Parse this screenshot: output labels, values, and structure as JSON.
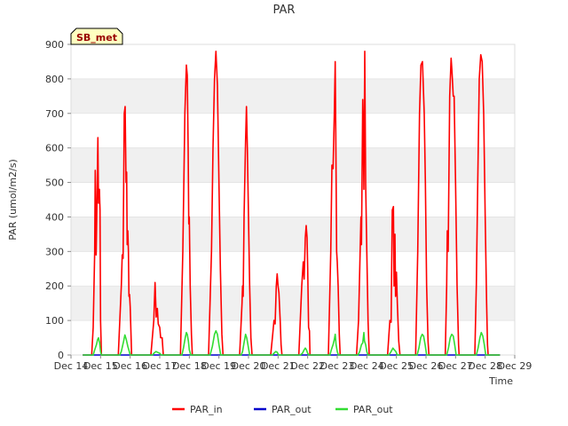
{
  "chart_data": {
    "type": "line",
    "title": "PAR",
    "xlabel": "Time",
    "ylabel": "PAR (umol/m2/s)",
    "ylim": [
      0,
      900
    ],
    "xlim": [
      14,
      29
    ],
    "yticks": [
      0,
      100,
      200,
      300,
      400,
      500,
      600,
      700,
      800,
      900
    ],
    "xtick_values": [
      14,
      15,
      16,
      17,
      18,
      19,
      20,
      21,
      22,
      23,
      24,
      25,
      26,
      27,
      28,
      29
    ],
    "xtick_labels": [
      "Dec 14",
      "Dec 15",
      "Dec 16",
      "Dec 17",
      "Dec 18",
      "Dec 19",
      "Dec 20",
      "Dec 21",
      "Dec 22",
      "Dec 23",
      "Dec 24",
      "Dec 25",
      "Dec 26",
      "Dec 27",
      "Dec 28",
      "Dec 29"
    ],
    "grid": "horizontal bands",
    "legend_placement": "bottom-center",
    "site_label": "SB_met",
    "series": [
      {
        "name": "PAR_in",
        "color": "#ff0000",
        "points": [
          [
            14.4,
            0
          ],
          [
            14.7,
            0
          ],
          [
            14.75,
            80
          ],
          [
            14.8,
            300
          ],
          [
            14.82,
            535
          ],
          [
            14.85,
            290
          ],
          [
            14.88,
            450
          ],
          [
            14.91,
            630
          ],
          [
            14.93,
            440
          ],
          [
            14.96,
            480
          ],
          [
            14.98,
            420
          ],
          [
            15.0,
            100
          ],
          [
            15.03,
            0
          ],
          [
            15.6,
            0
          ],
          [
            15.7,
            200
          ],
          [
            15.73,
            290
          ],
          [
            15.76,
            280
          ],
          [
            15.8,
            700
          ],
          [
            15.83,
            720
          ],
          [
            15.86,
            500
          ],
          [
            15.88,
            530
          ],
          [
            15.9,
            320
          ],
          [
            15.92,
            360
          ],
          [
            15.94,
            300
          ],
          [
            15.96,
            170
          ],
          [
            15.98,
            175
          ],
          [
            16.0,
            140
          ],
          [
            16.05,
            0
          ],
          [
            16.7,
            0
          ],
          [
            16.8,
            100
          ],
          [
            16.84,
            210
          ],
          [
            16.88,
            110
          ],
          [
            16.92,
            135
          ],
          [
            16.95,
            90
          ],
          [
            17.0,
            80
          ],
          [
            17.03,
            50
          ],
          [
            17.08,
            50
          ],
          [
            17.12,
            0
          ],
          [
            17.7,
            0
          ],
          [
            17.78,
            300
          ],
          [
            17.85,
            700
          ],
          [
            17.9,
            840
          ],
          [
            17.93,
            810
          ],
          [
            17.96,
            600
          ],
          [
            17.98,
            380
          ],
          [
            18.0,
            400
          ],
          [
            18.03,
            200
          ],
          [
            18.07,
            60
          ],
          [
            18.1,
            0
          ],
          [
            18.65,
            0
          ],
          [
            18.75,
            300
          ],
          [
            18.8,
            600
          ],
          [
            18.85,
            800
          ],
          [
            18.9,
            880
          ],
          [
            18.95,
            780
          ],
          [
            19.0,
            500
          ],
          [
            19.05,
            250
          ],
          [
            19.1,
            60
          ],
          [
            19.14,
            0
          ],
          [
            19.7,
            0
          ],
          [
            19.78,
            150
          ],
          [
            19.8,
            200
          ],
          [
            19.82,
            170
          ],
          [
            19.85,
            400
          ],
          [
            19.9,
            620
          ],
          [
            19.93,
            720
          ],
          [
            19.96,
            600
          ],
          [
            20.0,
            400
          ],
          [
            20.04,
            200
          ],
          [
            20.08,
            50
          ],
          [
            20.12,
            0
          ],
          [
            20.75,
            0
          ],
          [
            20.82,
            60
          ],
          [
            20.86,
            100
          ],
          [
            20.9,
            90
          ],
          [
            20.94,
            200
          ],
          [
            20.97,
            235
          ],
          [
            21.0,
            200
          ],
          [
            21.03,
            180
          ],
          [
            21.07,
            100
          ],
          [
            21.1,
            30
          ],
          [
            21.13,
            0
          ],
          [
            21.7,
            0
          ],
          [
            21.8,
            200
          ],
          [
            21.85,
            270
          ],
          [
            21.88,
            220
          ],
          [
            21.92,
            340
          ],
          [
            21.95,
            375
          ],
          [
            21.98,
            340
          ],
          [
            22.0,
            250
          ],
          [
            22.03,
            80
          ],
          [
            22.06,
            70
          ],
          [
            22.08,
            0
          ],
          [
            22.7,
            0
          ],
          [
            22.78,
            300
          ],
          [
            22.82,
            550
          ],
          [
            22.86,
            540
          ],
          [
            22.9,
            700
          ],
          [
            22.93,
            850
          ],
          [
            22.96,
            520
          ],
          [
            22.98,
            300
          ],
          [
            23.0,
            270
          ],
          [
            23.03,
            200
          ],
          [
            23.07,
            60
          ],
          [
            23.1,
            0
          ],
          [
            23.65,
            0
          ],
          [
            23.72,
            100
          ],
          [
            23.8,
            400
          ],
          [
            23.82,
            320
          ],
          [
            23.86,
            740
          ],
          [
            23.88,
            650
          ],
          [
            23.9,
            480
          ],
          [
            23.93,
            880
          ],
          [
            23.96,
            500
          ],
          [
            24.0,
            300
          ],
          [
            24.04,
            100
          ],
          [
            24.08,
            0
          ],
          [
            24.7,
            0
          ],
          [
            24.78,
            100
          ],
          [
            24.82,
            95
          ],
          [
            24.86,
            420
          ],
          [
            24.9,
            430
          ],
          [
            24.92,
            200
          ],
          [
            24.95,
            350
          ],
          [
            24.97,
            170
          ],
          [
            25.0,
            240
          ],
          [
            25.03,
            150
          ],
          [
            25.08,
            40
          ],
          [
            25.12,
            0
          ],
          [
            25.65,
            0
          ],
          [
            25.72,
            300
          ],
          [
            25.78,
            700
          ],
          [
            25.83,
            840
          ],
          [
            25.88,
            850
          ],
          [
            25.94,
            700
          ],
          [
            25.98,
            500
          ],
          [
            26.02,
            200
          ],
          [
            26.07,
            40
          ],
          [
            26.1,
            0
          ],
          [
            26.65,
            0
          ],
          [
            26.7,
            200
          ],
          [
            26.72,
            360
          ],
          [
            26.75,
            300
          ],
          [
            26.8,
            750
          ],
          [
            26.85,
            860
          ],
          [
            26.88,
            820
          ],
          [
            26.92,
            750
          ],
          [
            26.95,
            750
          ],
          [
            27.0,
            500
          ],
          [
            27.05,
            200
          ],
          [
            27.1,
            30
          ],
          [
            27.12,
            0
          ],
          [
            27.65,
            0
          ],
          [
            27.7,
            200
          ],
          [
            27.75,
            500
          ],
          [
            27.8,
            800
          ],
          [
            27.85,
            870
          ],
          [
            27.9,
            850
          ],
          [
            27.95,
            700
          ],
          [
            28.0,
            400
          ],
          [
            28.05,
            150
          ],
          [
            28.08,
            30
          ],
          [
            28.1,
            0
          ],
          [
            28.5,
            0
          ]
        ]
      },
      {
        "name": "PAR_out",
        "color": "#0000cc",
        "points": [
          [
            14.4,
            0
          ],
          [
            28.5,
            0
          ]
        ]
      },
      {
        "name": "PAR_out",
        "color": "#33dd33",
        "points": [
          [
            14.4,
            0
          ],
          [
            14.75,
            0
          ],
          [
            14.8,
            15
          ],
          [
            14.86,
            30
          ],
          [
            14.9,
            45
          ],
          [
            14.93,
            50
          ],
          [
            14.97,
            35
          ],
          [
            15.0,
            10
          ],
          [
            15.03,
            0
          ],
          [
            15.65,
            0
          ],
          [
            15.7,
            10
          ],
          [
            15.78,
            40
          ],
          [
            15.82,
            58
          ],
          [
            15.87,
            45
          ],
          [
            15.92,
            25
          ],
          [
            15.97,
            10
          ],
          [
            16.0,
            0
          ],
          [
            16.75,
            0
          ],
          [
            16.8,
            5
          ],
          [
            16.87,
            10
          ],
          [
            16.95,
            7
          ],
          [
            17.0,
            5
          ],
          [
            17.05,
            0
          ],
          [
            17.75,
            0
          ],
          [
            17.8,
            20
          ],
          [
            17.86,
            50
          ],
          [
            17.9,
            65
          ],
          [
            17.93,
            60
          ],
          [
            17.97,
            40
          ],
          [
            18.0,
            15
          ],
          [
            18.05,
            0
          ],
          [
            18.7,
            0
          ],
          [
            18.78,
            25
          ],
          [
            18.85,
            60
          ],
          [
            18.9,
            70
          ],
          [
            18.95,
            60
          ],
          [
            19.0,
            30
          ],
          [
            19.06,
            0
          ],
          [
            19.75,
            0
          ],
          [
            19.8,
            10
          ],
          [
            19.86,
            40
          ],
          [
            19.9,
            60
          ],
          [
            19.94,
            50
          ],
          [
            20.0,
            20
          ],
          [
            20.04,
            0
          ],
          [
            20.8,
            0
          ],
          [
            20.86,
            5
          ],
          [
            20.92,
            10
          ],
          [
            20.97,
            8
          ],
          [
            21.02,
            0
          ],
          [
            21.75,
            0
          ],
          [
            21.82,
            5
          ],
          [
            21.88,
            15
          ],
          [
            21.92,
            20
          ],
          [
            21.96,
            15
          ],
          [
            22.0,
            5
          ],
          [
            22.04,
            0
          ],
          [
            22.75,
            0
          ],
          [
            22.8,
            15
          ],
          [
            22.86,
            30
          ],
          [
            22.9,
            45
          ],
          [
            22.93,
            60
          ],
          [
            22.96,
            30
          ],
          [
            23.0,
            10
          ],
          [
            23.04,
            0
          ],
          [
            23.7,
            0
          ],
          [
            23.76,
            10
          ],
          [
            23.82,
            30
          ],
          [
            23.86,
            35
          ],
          [
            23.9,
            65
          ],
          [
            23.92,
            40
          ],
          [
            23.96,
            30
          ],
          [
            24.0,
            10
          ],
          [
            24.04,
            0
          ],
          [
            24.75,
            0
          ],
          [
            24.82,
            10
          ],
          [
            24.88,
            20
          ],
          [
            24.93,
            15
          ],
          [
            24.98,
            10
          ],
          [
            25.03,
            0
          ],
          [
            25.7,
            0
          ],
          [
            25.76,
            20
          ],
          [
            25.82,
            50
          ],
          [
            25.87,
            60
          ],
          [
            25.92,
            55
          ],
          [
            25.97,
            30
          ],
          [
            26.02,
            0
          ],
          [
            26.7,
            0
          ],
          [
            26.76,
            20
          ],
          [
            26.82,
            50
          ],
          [
            26.87,
            60
          ],
          [
            26.92,
            55
          ],
          [
            26.97,
            30
          ],
          [
            27.02,
            0
          ],
          [
            27.7,
            0
          ],
          [
            27.76,
            20
          ],
          [
            27.82,
            50
          ],
          [
            27.87,
            65
          ],
          [
            27.92,
            55
          ],
          [
            27.97,
            30
          ],
          [
            28.02,
            0
          ],
          [
            28.5,
            0
          ]
        ]
      }
    ]
  }
}
